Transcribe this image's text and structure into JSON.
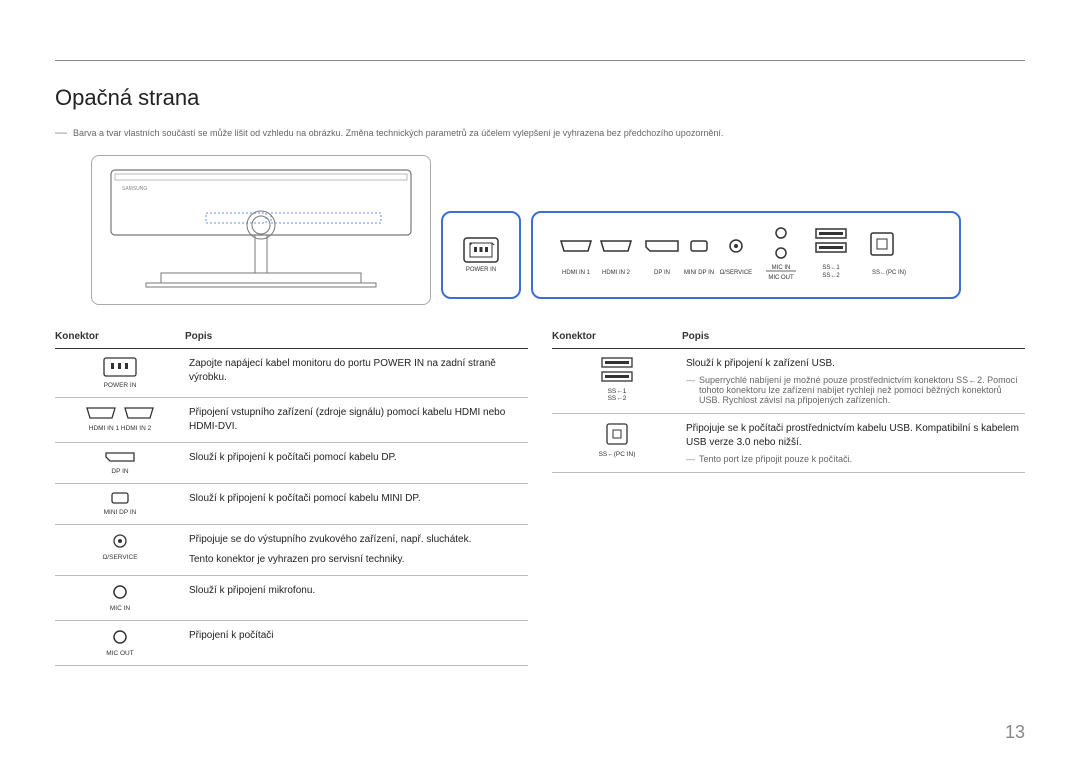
{
  "title": "Opačná strana",
  "disclaimer": "Barva a tvar vlastních součástí se může lišit od vzhledu na obrázku. Změna technických parametrů za účelem vylepšení je vyhrazena bez předchozího upozornění.",
  "diagram": {
    "power_label": "POWER IN",
    "ports": [
      "HDMI IN 1",
      "HDMI IN 2",
      "DP IN",
      "MINI DP IN",
      "Ω/SERVICE",
      "MIC IN",
      "MIC OUT",
      "SS←1",
      "SS←2",
      "SS←(PC IN)"
    ]
  },
  "table_headers": {
    "konektor": "Konektor",
    "popis": "Popis"
  },
  "left_rows": [
    {
      "label": "POWER IN",
      "desc": "Zapojte napájecí kabel monitoru do portu POWER IN na zadní straně výrobku."
    },
    {
      "label": "HDMI IN 1     HDMI IN 2",
      "desc": "Připojení vstupního zařízení (zdroje signálu) pomocí kabelu HDMI nebo HDMI-DVI."
    },
    {
      "label": "DP IN",
      "desc": "Slouží k připojení k počítači pomocí kabelu DP."
    },
    {
      "label": "MINI DP IN",
      "desc": "Slouží k připojení k počítači pomocí kabelu MINI DP."
    },
    {
      "label": "Ω/SERVICE",
      "desc": "Připojuje se do výstupního zvukového zařízení, např. sluchátek.",
      "desc2": "Tento konektor je vyhrazen pro servisní techniky."
    },
    {
      "label": "MIC IN",
      "desc": "Slouží k připojení mikrofonu."
    },
    {
      "label": "MIC OUT",
      "desc": "Připojení k počítači"
    }
  ],
  "right_rows": [
    {
      "label": "SS←1\nSS←2",
      "desc": "Slouží k připojení k zařízení USB.",
      "note": "Superrychlé nabíjení je možné pouze prostřednictvím konektoru SS←2. Pomocí tohoto konektoru lze zařízení nabíjet rychleji než pomocí běžných konektorů USB. Rychlost závisí na připojených zařízeních."
    },
    {
      "label": "SS←(PC IN)",
      "desc": "Připojuje se k počítači prostřednictvím kabelu USB. Kompatibilní s kabelem USB verze 3.0 nebo nižší.",
      "note": "Tento port lze připojit pouze k počítači."
    }
  ],
  "page_number": "13"
}
